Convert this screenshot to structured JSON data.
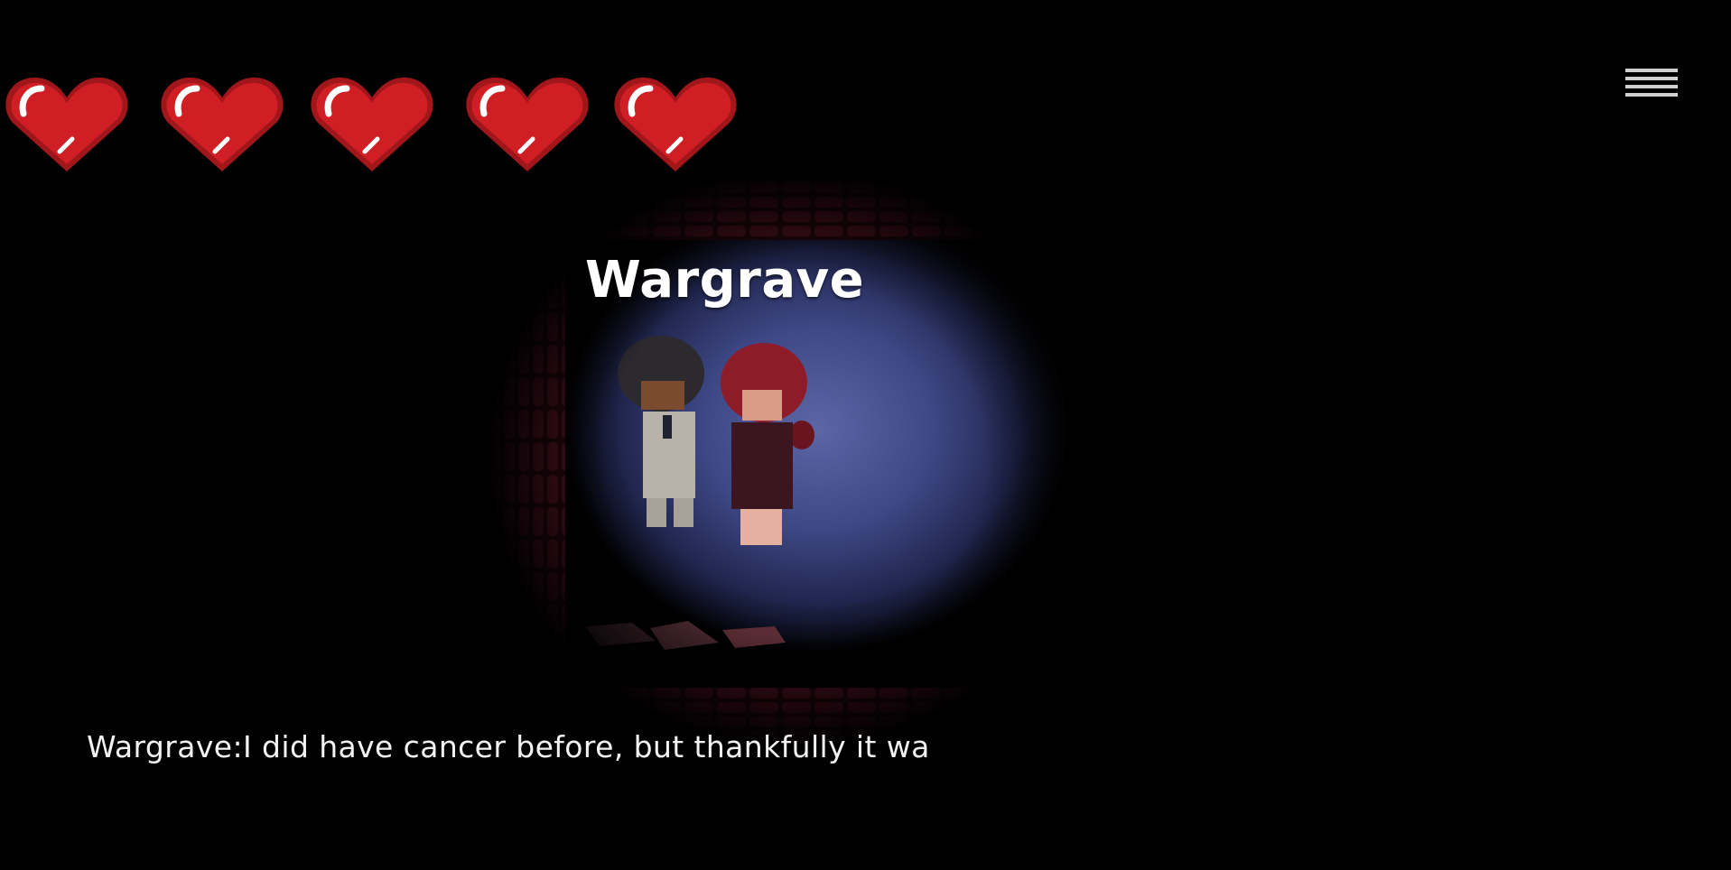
{
  "hud": {
    "hearts": [
      {
        "state": "full"
      },
      {
        "state": "full"
      },
      {
        "state": "full"
      },
      {
        "state": "full"
      },
      {
        "state": "full"
      }
    ],
    "heart_color": "#c4181d",
    "menu_icon": "hamburger-menu-icon"
  },
  "scene": {
    "speaker_name": "Wargrave",
    "spotlight_color": "#4a5490",
    "wall_color": "#3a0d18"
  },
  "dialogue": {
    "text": "Wargrave:I did have cancer before, but thankfully it wa"
  }
}
